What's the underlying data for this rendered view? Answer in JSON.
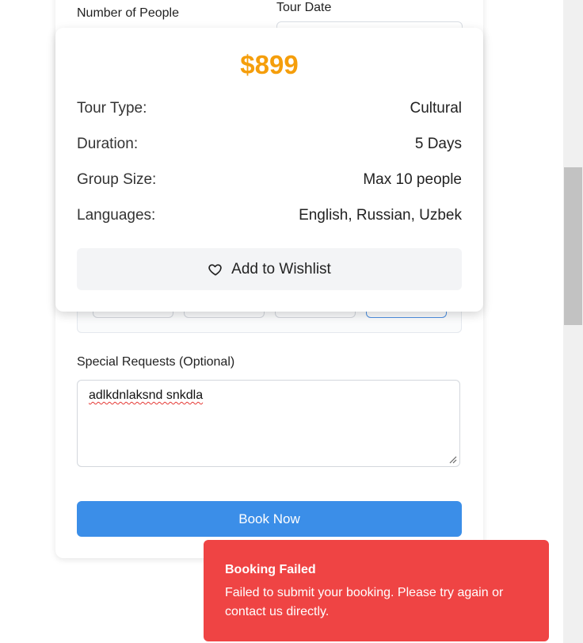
{
  "booking_form": {
    "people_label": "Number of People",
    "date_label": "Tour Date",
    "requests_label": "Special Requests (Optional)",
    "requests_value": "adlkdnlaksnd snkdla",
    "book_button": "Book Now"
  },
  "summary": {
    "price": "$899",
    "rows": [
      {
        "key": "Tour Type:",
        "value": "Cultural"
      },
      {
        "key": "Duration:",
        "value": "5 Days"
      },
      {
        "key": "Group Size:",
        "value": "Max 10 people"
      },
      {
        "key": "Languages:",
        "value": "English, Russian, Uzbek"
      }
    ],
    "wishlist_button": "Add to Wishlist"
  },
  "toast": {
    "title": "Booking Failed",
    "message": "Failed to submit your booking. Please try again or contact us directly."
  },
  "icons": {
    "calendar": "calendar-icon",
    "wishlist": "heart-icon"
  },
  "colors": {
    "price": "#f59e0b",
    "primary_button": "#3b8ee8",
    "toast_error": "#ef4444"
  }
}
